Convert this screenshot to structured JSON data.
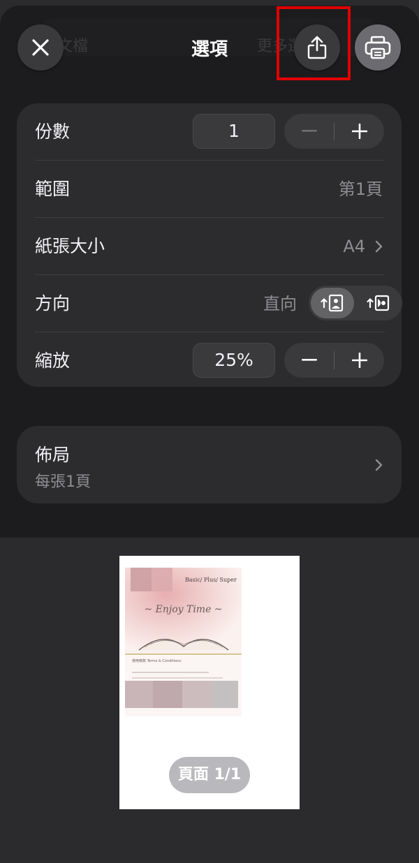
{
  "header": {
    "title": "選項",
    "ghost_left": "文檔",
    "ghost_right": "更多選項",
    "close_icon": "close-icon",
    "share_icon": "share-icon",
    "print_icon": "printer-icon",
    "highlight_color": "#e10000"
  },
  "options": {
    "copies": {
      "label": "份數",
      "value": "1"
    },
    "range": {
      "label": "範圍",
      "value": "第1頁"
    },
    "paper_size": {
      "label": "紙張大小",
      "value": "A4"
    },
    "orientation": {
      "label": "方向",
      "value": "直向",
      "options": [
        "portrait-icon",
        "landscape-icon"
      ],
      "selected": "portrait-icon"
    },
    "scale": {
      "label": "縮放",
      "value": "25%"
    }
  },
  "layout": {
    "label": "佈局",
    "value": "每張1頁"
  },
  "preview": {
    "page_badge": "頁面 1/1",
    "doc_brand": "Basic/ Plus/ Super",
    "doc_title": "~ Enjoy Time ~",
    "doc_terms_heading": "使用條款 Terms & Conditions:"
  },
  "colors": {
    "background": "#2b2b2d",
    "sheet": "#1c1c1e",
    "card": "#2c2c2e",
    "control": "#3a3a3c",
    "secondary_text": "#8e8e93"
  }
}
